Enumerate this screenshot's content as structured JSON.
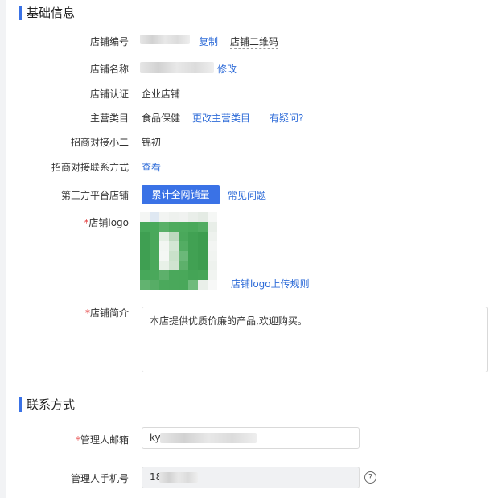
{
  "sections": {
    "basic_title": "基础信息",
    "contact_title": "联系方式"
  },
  "fields": {
    "shop_id": {
      "label": "店铺编号",
      "copy_link": "复制",
      "qr_link": "店铺二维码"
    },
    "shop_name": {
      "label": "店铺名称",
      "edit_link": "修改"
    },
    "certification": {
      "label": "店铺认证",
      "value": "企业店铺"
    },
    "category": {
      "label": "主营类目",
      "value": "食品保健",
      "change_link": "更改主营类目",
      "question_link": "有疑问?"
    },
    "contact_staff": {
      "label": "招商对接小二",
      "value": "锦初"
    },
    "contact_method": {
      "label": "招商对接联系方式",
      "view_link": "查看"
    },
    "third_party": {
      "label": "第三方平台店铺",
      "button": "累计全网销量",
      "faq_link": "常见问题"
    },
    "logo": {
      "label": "店铺logo",
      "rules_link": "店铺logo上传规则"
    },
    "intro": {
      "label": "店铺简介",
      "value": "本店提供优质价廉的产品,欢迎购买。"
    },
    "email": {
      "label": "管理人邮箱",
      "value": "ky"
    },
    "phone": {
      "label": "管理人手机号",
      "value": "18"
    }
  },
  "colors": {
    "accent": "#3a72e6",
    "link": "#2f6cd8",
    "required": "#e64545"
  },
  "icons": {
    "help": "question-circle-icon"
  }
}
